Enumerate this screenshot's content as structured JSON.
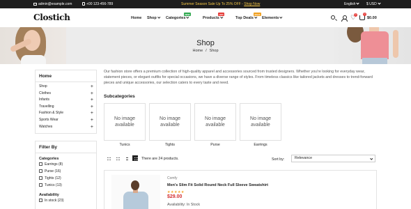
{
  "topbar": {
    "email": "admin@example.com",
    "phone": "+00 123-456-789",
    "promo": "Summer Season Sale Up To 25% OFF -",
    "promo_link": "Shop Now",
    "language": "English",
    "currency": "$ USD"
  },
  "header": {
    "logo": "Clostich",
    "nav": [
      {
        "label": "Home"
      },
      {
        "label": "Shop"
      },
      {
        "label": "Categories",
        "badge": "NEW"
      },
      {
        "label": "Products",
        "badge": "HOT"
      },
      {
        "label": "Top Deals",
        "badge": "SALE"
      },
      {
        "label": "Elements"
      }
    ],
    "wishlist_count": "0",
    "cart_count": "0",
    "cart_total": "$0.00"
  },
  "hero": {
    "title": "Shop",
    "breadcrumb": [
      "Home",
      "/",
      "Shop"
    ]
  },
  "sidebar": {
    "home_title": "Home",
    "categories": [
      "Shop",
      "Clothes",
      "Infants",
      "Travelling",
      "Fashion & Style",
      "Sports Wear",
      "Watches"
    ],
    "filter_title": "Filter By",
    "filter_categories_title": "Categories",
    "filter_categories": [
      "Earrings (8)",
      "Purse (16)",
      "Tights (12)",
      "Tunics (13)"
    ],
    "availability_title": "Availability",
    "availability": [
      "In stock (23)"
    ]
  },
  "main": {
    "intro": "Our fashion store offers a premium collection of high-quality apparel and accessories sourced from trusted designers. Whether you're looking for everyday wear, statement pieces, or elegant outfits for special occasions, we have a diverse range of styles. From timeless classics like tailored jackets and dresses to trend-forward pieces and unique accessories, our selection caters to every taste and need.",
    "subcategories_title": "Subcategories",
    "no_image": [
      "No image",
      "available"
    ],
    "subcategories": [
      "Tunics",
      "Tights",
      "Purse",
      "Earrings"
    ],
    "product_count": "There are 24 products.",
    "sort_label": "Sort by:",
    "sort_value": "Relevance",
    "product": {
      "brand": "Comfy",
      "name": "Men's Slim Fit Solid Round Neck Full Sleeve Sweatshirt",
      "stars": "★★★★★",
      "price": "$29.00",
      "availability": "Availability: In Stock"
    }
  },
  "colors": {
    "topbar_bg": "#1d1d1d",
    "promo": "#f6c846",
    "price": "#d32f2f",
    "badge_new": "#2fa84f",
    "badge_hot": "#e53935",
    "badge_sale": "#f0a020"
  },
  "icons": [
    "mail-icon",
    "phone-icon",
    "search-icon",
    "user-icon",
    "heart-icon",
    "cart-icon",
    "plus-icon",
    "grid-view-icon",
    "list-view-icon"
  ]
}
